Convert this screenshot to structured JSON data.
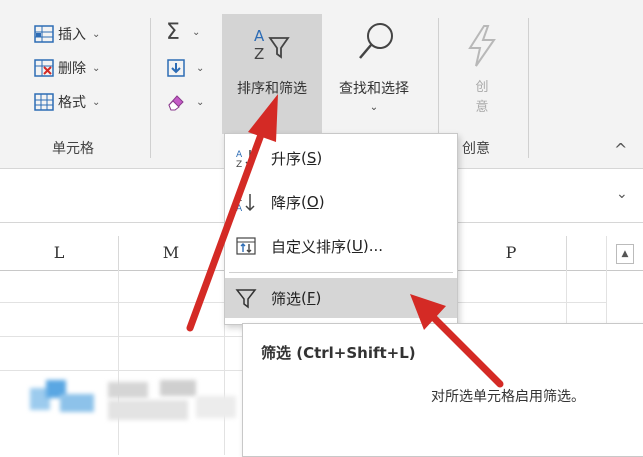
{
  "ribbon": {
    "cells_group": {
      "insert_label": "插入",
      "delete_label": "删除",
      "format_label": "格式",
      "group_label": "单元格"
    },
    "editing_group": {
      "sort_filter_label": "排序和筛选",
      "find_select_label": "查找和选择"
    },
    "ideas_group": {
      "button_label_line1": "创",
      "button_label_line2": "意",
      "group_label": "创意"
    }
  },
  "columns": [
    "L",
    "M",
    "P"
  ],
  "dropdown": {
    "items": [
      {
        "label": "升序",
        "shortcut": "S"
      },
      {
        "label": "降序",
        "shortcut": "O"
      },
      {
        "label": "自定义排序",
        "shortcut": "U",
        "suffix": "..."
      },
      {
        "label": "筛选",
        "shortcut": "F"
      }
    ]
  },
  "tooltip": {
    "title": "筛选 (Ctrl+Shift+L)",
    "description": "对所选单元格启用筛选。"
  },
  "colors": {
    "arrow": "#d42a25",
    "hover": "#d6d6d6",
    "accent": "#2d6cb5"
  }
}
